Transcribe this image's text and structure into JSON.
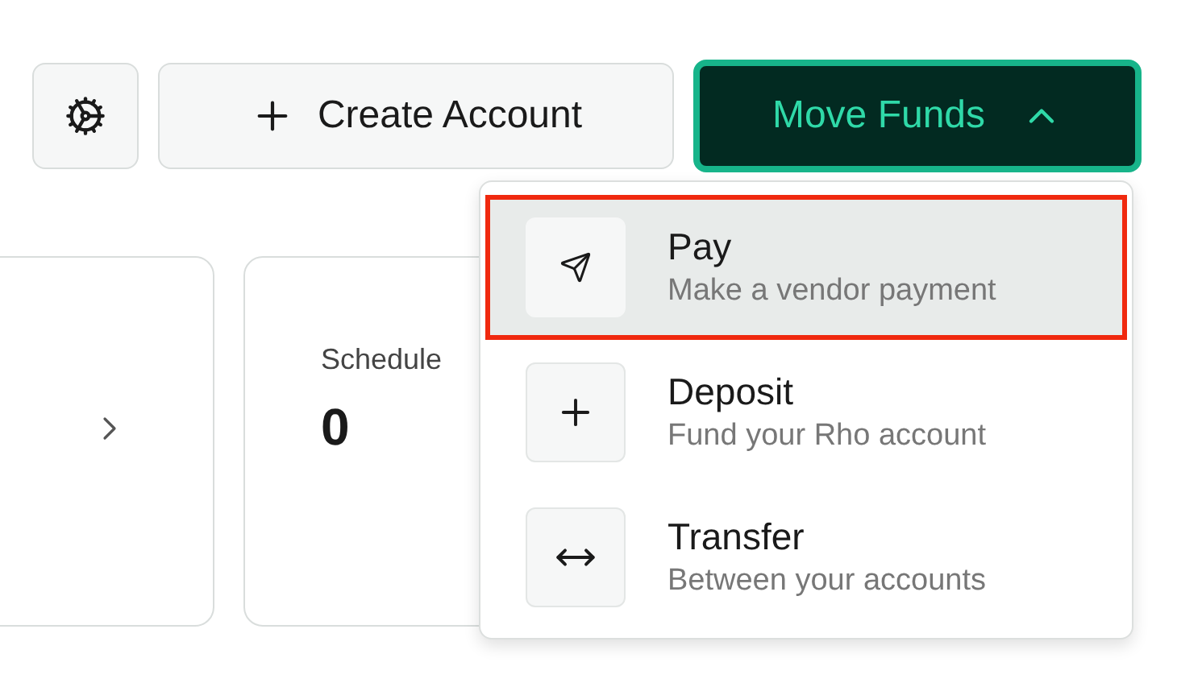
{
  "toolbar": {
    "create_button": "Create Account",
    "move_button": {
      "label": "Move Funds",
      "expanded": true
    }
  },
  "cards": [
    {
      "kind": "link"
    },
    {
      "kind": "stat",
      "title": "Schedule",
      "value": "0"
    }
  ],
  "menu": {
    "items": [
      {
        "kind": "send",
        "label": "Pay",
        "description": "Make a vendor payment",
        "selected": true
      },
      {
        "kind": "plus",
        "label": "Deposit",
        "description": "Fund your Rho account",
        "selected": false
      },
      {
        "kind": "arrows",
        "label": "Transfer",
        "description": "Between your accounts",
        "selected": false
      }
    ]
  }
}
